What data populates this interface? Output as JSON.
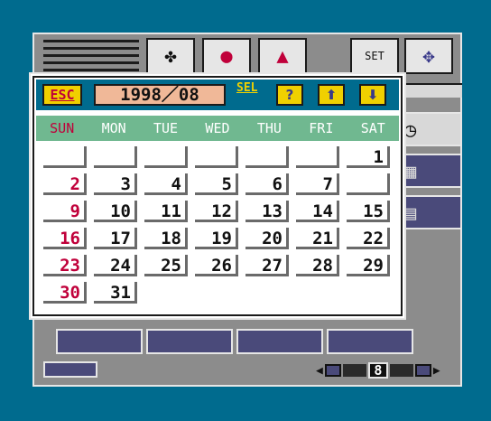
{
  "device": {
    "top_buttons": [
      {
        "name": "clover-icon",
        "glyph": "✤"
      },
      {
        "name": "mouse-icon",
        "glyph": "●"
      },
      {
        "name": "mouse-cursor-icon",
        "glyph": "▲"
      },
      {
        "name": "set-clock-icon",
        "glyph": "SET"
      },
      {
        "name": "move-arrows-icon",
        "glyph": "✥"
      }
    ],
    "page_number": "8"
  },
  "calendar": {
    "esc_label": "ESC",
    "date_display": "1998／08",
    "sel_label": "SEL",
    "help_label": "?",
    "up_label": "⬆",
    "down_label": "⬇",
    "weekdays": [
      "SUN",
      "MON",
      "TUE",
      "WED",
      "THU",
      "FRI",
      "SAT"
    ],
    "weeks": [
      [
        "",
        "",
        "",
        "",
        "",
        "",
        "1"
      ],
      [
        "2",
        "3",
        "4",
        "5",
        "6",
        "7",
        ""
      ],
      [
        "9",
        "10",
        "11",
        "12",
        "13",
        "14",
        "15"
      ],
      [
        "16",
        "17",
        "18",
        "19",
        "20",
        "21",
        "22"
      ],
      [
        "23",
        "24",
        "25",
        "26",
        "27",
        "28",
        "29"
      ],
      [
        "30",
        "31",
        "",
        "",
        "",
        "",
        ""
      ]
    ]
  },
  "colors": {
    "sunday": "#c0003a",
    "header": "#006b8e",
    "weekday_bar": "#70b890",
    "esc": "#f0d000",
    "date": "#f0b898"
  }
}
